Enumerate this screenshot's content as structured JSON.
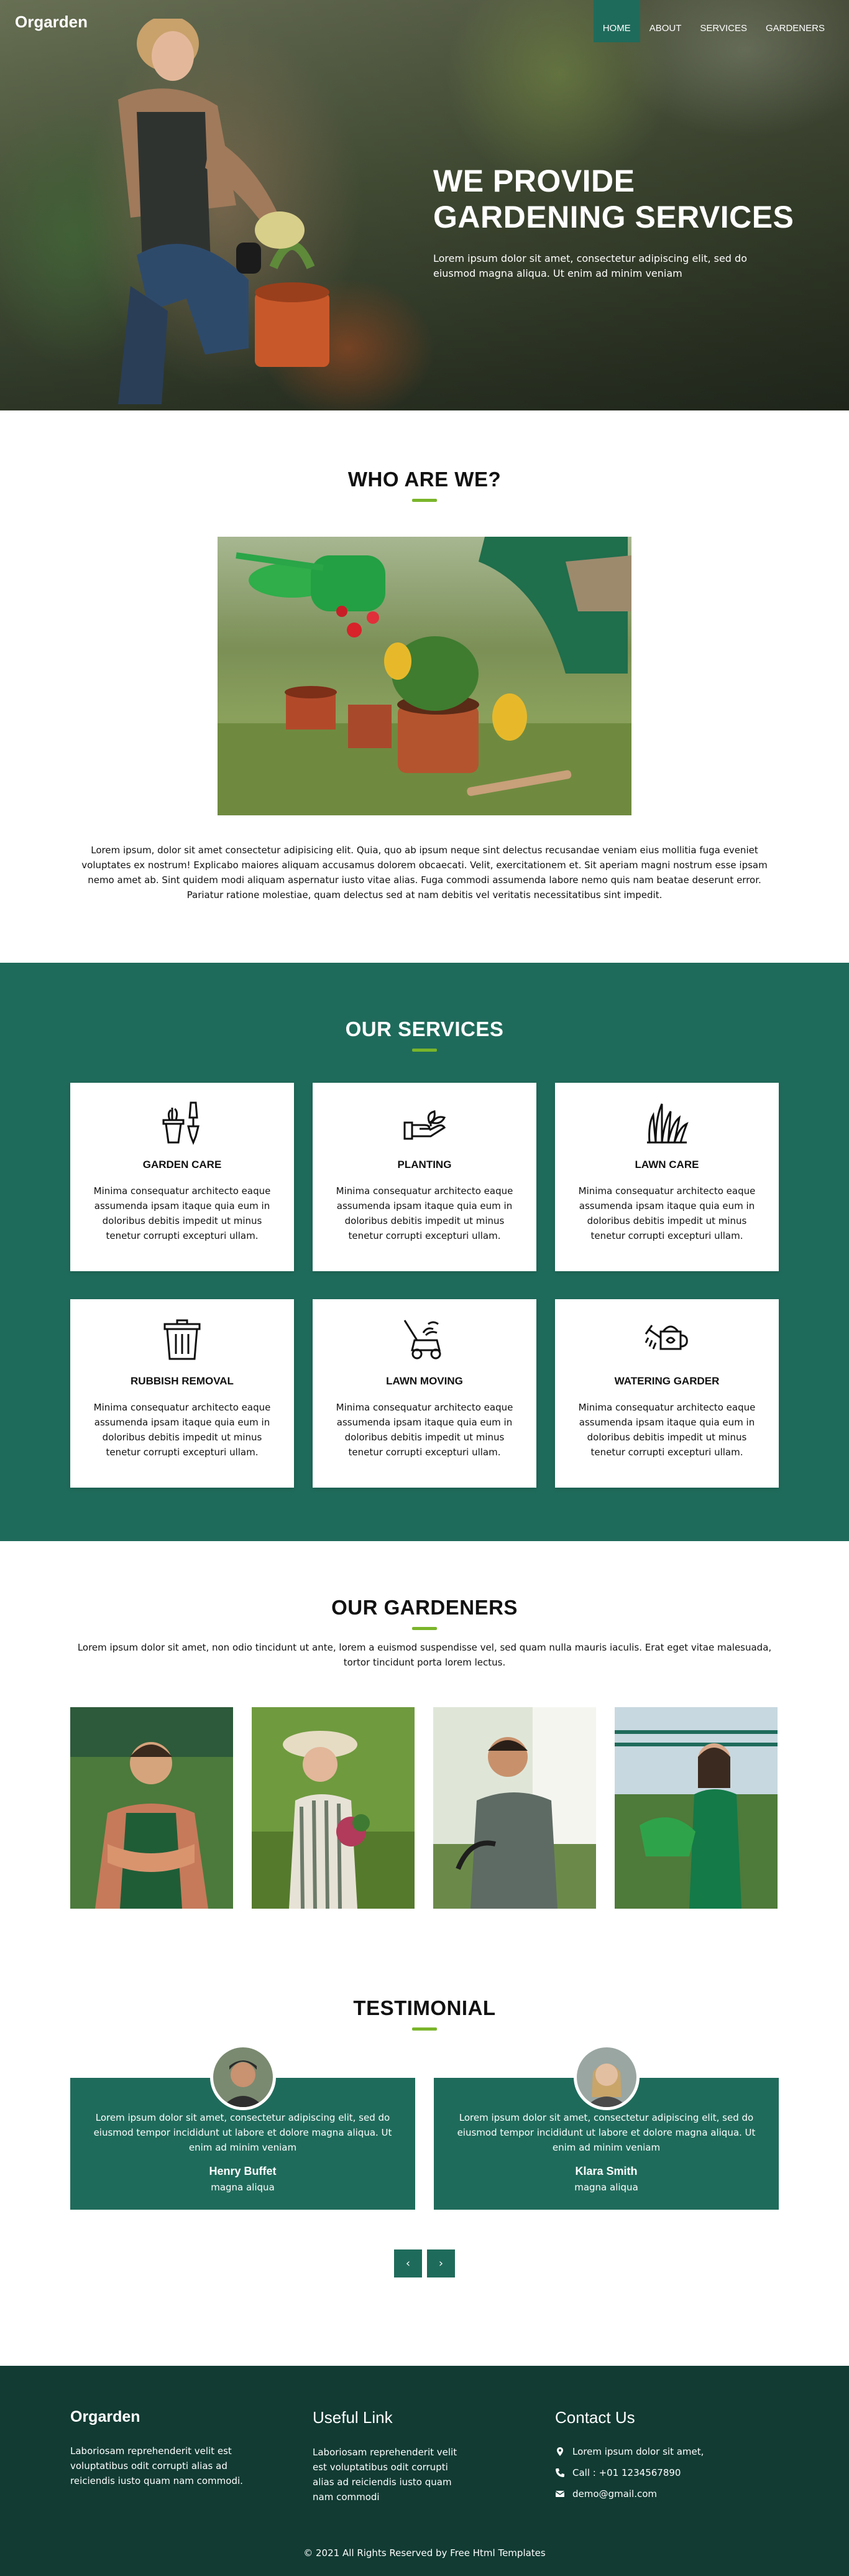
{
  "header": {
    "logo": "Orgarden",
    "nav": [
      {
        "label": "HOME",
        "active": true
      },
      {
        "label": "ABOUT",
        "active": false
      },
      {
        "label": "SERVICES",
        "active": false
      },
      {
        "label": "GARDENERS",
        "active": false
      }
    ]
  },
  "hero": {
    "title_line1": "WE PROVIDE",
    "title_line2": "GARDENING SERVICES",
    "text": "Lorem ipsum dolor sit amet, consectetur adipiscing elit, sed do eiusmod magna aliqua. Ut enim ad minim veniam"
  },
  "about": {
    "title_a": "WHO ",
    "title_b": "ARE WE?",
    "text": "Lorem ipsum, dolor sit amet consectetur adipisicing elit. Quia, quo ab ipsum neque sint delectus recusandae veniam eius mollitia fuga eveniet voluptates ex nostrum! Explicabo maiores aliquam accusamus dolorem obcaecati. Velit, exercitationem et. Sit aperiam magni nostrum esse ipsam nemo amet ab. Sint quidem modi aliquam aspernatur iusto vitae alias. Fuga commodi assumenda labore nemo quis nam beatae deserunt error. Pariatur ratione molestiae, quam delectus sed at nam debitis vel veritatis necessitatibus sint impedit."
  },
  "services": {
    "title_a": "OUR ",
    "title_b": "SERVICES",
    "items": [
      {
        "title": "GARDEN CARE",
        "icon": "garden-tools-icon",
        "text": "Minima consequatur architecto eaque assumenda ipsam itaque quia eum in doloribus debitis impedit ut minus tenetur corrupti excepturi ullam."
      },
      {
        "title": "PLANTING",
        "icon": "planting-hand-icon",
        "text": "Minima consequatur architecto eaque assumenda ipsam itaque quia eum in doloribus debitis impedit ut minus tenetur corrupti excepturi ullam."
      },
      {
        "title": "LAWN CARE",
        "icon": "grass-icon",
        "text": "Minima consequatur architecto eaque assumenda ipsam itaque quia eum in doloribus debitis impedit ut minus tenetur corrupti excepturi ullam."
      },
      {
        "title": "RUBBISH REMOVAL",
        "icon": "trash-bin-icon",
        "text": "Minima consequatur architecto eaque assumenda ipsam itaque quia eum in doloribus debitis impedit ut minus tenetur corrupti excepturi ullam."
      },
      {
        "title": "LAWN MOVING",
        "icon": "lawn-mower-icon",
        "text": "Minima consequatur architecto eaque assumenda ipsam itaque quia eum in doloribus debitis impedit ut minus tenetur corrupti excepturi ullam."
      },
      {
        "title": "WATERING GARDER",
        "icon": "watering-can-icon",
        "text": "Minima consequatur architecto eaque assumenda ipsam itaque quia eum in doloribus debitis impedit ut minus tenetur corrupti excepturi ullam."
      }
    ]
  },
  "gardeners": {
    "title_a": "OUR ",
    "title_b": "GARDENERS",
    "text": "Lorem ipsum dolor sit amet, non odio tincidunt ut ante, lorem a euismod suspendisse vel, sed quam nulla mauris iaculis. Erat eget vitae malesuada, tortor tincidunt porta lorem lectus."
  },
  "testimonial": {
    "title": "TESTIMONIAL",
    "items": [
      {
        "text": "Lorem ipsum dolor sit amet, consectetur adipiscing elit, sed do eiusmod tempor incididunt ut labore et dolore magna aliqua. Ut enim ad minim veniam",
        "name": "Henry Buffet",
        "role": "magna aliqua"
      },
      {
        "text": "Lorem ipsum dolor sit amet, consectetur adipiscing elit, sed do eiusmod tempor incididunt ut labore et dolore magna aliqua. Ut enim ad minim veniam",
        "name": "Klara Smith",
        "role": "magna aliqua"
      }
    ],
    "prev": "‹",
    "next": "›"
  },
  "footer": {
    "brand": "Orgarden",
    "brand_text": "Laboriosam reprehenderit velit est voluptatibus odit corrupti alias ad reiciendis iusto quam nam commodi.",
    "links_title": "Useful Link",
    "links_text": "Laboriosam reprehenderit velit est voluptatibus odit corrupti alias ad reiciendis iusto quam nam commodi",
    "contact_title": "Contact Us",
    "address": "Lorem ipsum dolor sit amet,",
    "phone": "Call : +01 1234567890",
    "email": "demo@gmail.com",
    "copyright": "© 2021 All Rights Reserved by Free Html Templates"
  },
  "colors": {
    "primary": "#1f6b5b",
    "accent": "#7ab52a",
    "footer": "#113b33"
  }
}
